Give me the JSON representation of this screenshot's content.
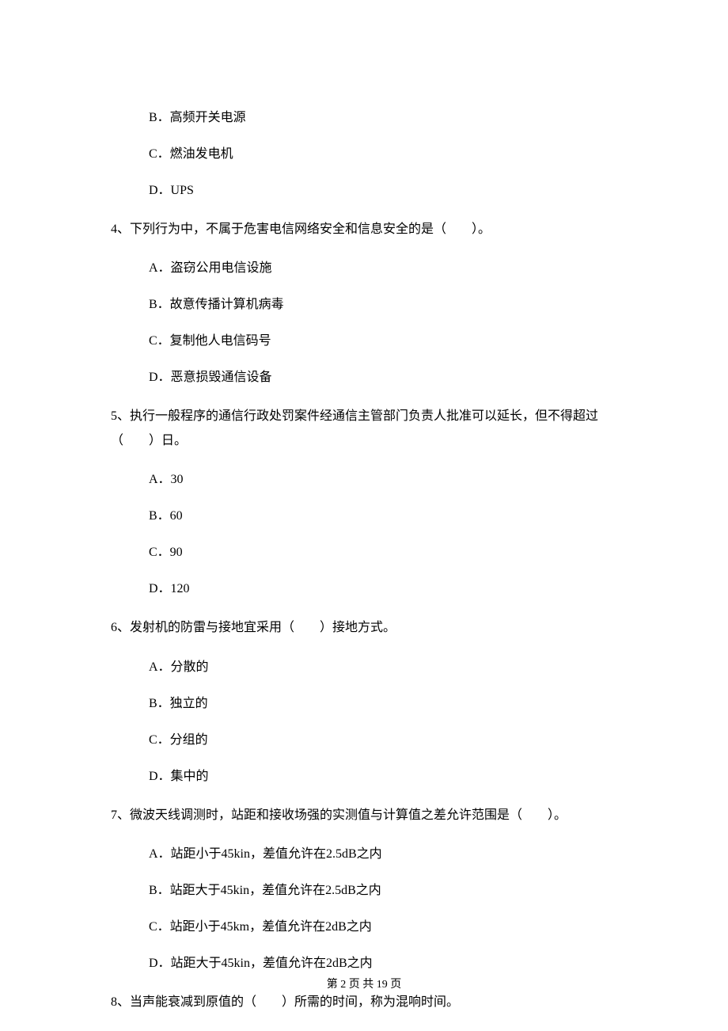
{
  "options_pre": [
    "B．高频开关电源",
    "C．燃油发电机",
    "D．UPS"
  ],
  "q4": {
    "text": "4、下列行为中，不属于危害电信网络安全和信息安全的是（　　）。",
    "opts": [
      "A．盗窃公用电信设施",
      "B．故意传播计算机病毒",
      "C．复制他人电信码号",
      "D．恶意损毁通信设备"
    ]
  },
  "q5": {
    "text": "5、执行一般程序的通信行政处罚案件经通信主管部门负责人批准可以延长，但不得超过（　　）日。",
    "opts": [
      "A．30",
      "B．60",
      "C．90",
      "D．120"
    ]
  },
  "q6": {
    "text": "6、发射机的防雷与接地宜采用（　　）接地方式。",
    "opts": [
      "A．分散的",
      "B．独立的",
      "C．分组的",
      "D．集中的"
    ]
  },
  "q7": {
    "text": "7、微波天线调测时，站距和接收场强的实测值与计算值之差允许范围是（　　）。",
    "opts": [
      "A．站距小于45kin，差值允许在2.5dB之内",
      "B．站距大于45kin，差值允许在2.5dB之内",
      "C．站距小于45km，差值允许在2dB之内",
      "D．站距大于45kin，差值允许在2dB之内"
    ]
  },
  "q8": {
    "text": "8、当声能衰减到原值的（　　）所需的时间，称为混响时间。"
  },
  "footer": "第 2 页 共 19 页"
}
